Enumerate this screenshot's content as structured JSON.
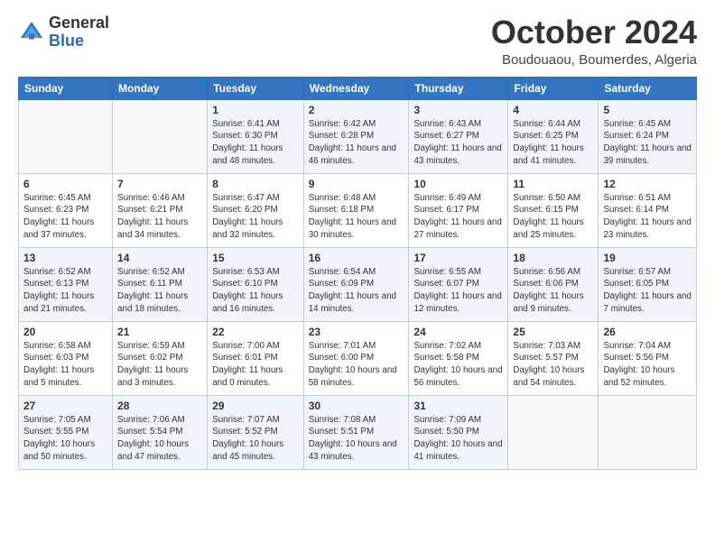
{
  "logo": {
    "general": "General",
    "blue": "Blue"
  },
  "header": {
    "month": "October 2024",
    "location": "Boudouaou, Boumerdes, Algeria"
  },
  "weekdays": [
    "Sunday",
    "Monday",
    "Tuesday",
    "Wednesday",
    "Thursday",
    "Friday",
    "Saturday"
  ],
  "weeks": [
    [
      {
        "day": "",
        "info": ""
      },
      {
        "day": "",
        "info": ""
      },
      {
        "day": "1",
        "info": "Sunrise: 6:41 AM\nSunset: 6:30 PM\nDaylight: 11 hours and 48 minutes."
      },
      {
        "day": "2",
        "info": "Sunrise: 6:42 AM\nSunset: 6:28 PM\nDaylight: 11 hours and 46 minutes."
      },
      {
        "day": "3",
        "info": "Sunrise: 6:43 AM\nSunset: 6:27 PM\nDaylight: 11 hours and 43 minutes."
      },
      {
        "day": "4",
        "info": "Sunrise: 6:44 AM\nSunset: 6:25 PM\nDaylight: 11 hours and 41 minutes."
      },
      {
        "day": "5",
        "info": "Sunrise: 6:45 AM\nSunset: 6:24 PM\nDaylight: 11 hours and 39 minutes."
      }
    ],
    [
      {
        "day": "6",
        "info": "Sunrise: 6:45 AM\nSunset: 6:23 PM\nDaylight: 11 hours and 37 minutes."
      },
      {
        "day": "7",
        "info": "Sunrise: 6:46 AM\nSunset: 6:21 PM\nDaylight: 11 hours and 34 minutes."
      },
      {
        "day": "8",
        "info": "Sunrise: 6:47 AM\nSunset: 6:20 PM\nDaylight: 11 hours and 32 minutes."
      },
      {
        "day": "9",
        "info": "Sunrise: 6:48 AM\nSunset: 6:18 PM\nDaylight: 11 hours and 30 minutes."
      },
      {
        "day": "10",
        "info": "Sunrise: 6:49 AM\nSunset: 6:17 PM\nDaylight: 11 hours and 27 minutes."
      },
      {
        "day": "11",
        "info": "Sunrise: 6:50 AM\nSunset: 6:15 PM\nDaylight: 11 hours and 25 minutes."
      },
      {
        "day": "12",
        "info": "Sunrise: 6:51 AM\nSunset: 6:14 PM\nDaylight: 11 hours and 23 minutes."
      }
    ],
    [
      {
        "day": "13",
        "info": "Sunrise: 6:52 AM\nSunset: 6:13 PM\nDaylight: 11 hours and 21 minutes."
      },
      {
        "day": "14",
        "info": "Sunrise: 6:52 AM\nSunset: 6:11 PM\nDaylight: 11 hours and 18 minutes."
      },
      {
        "day": "15",
        "info": "Sunrise: 6:53 AM\nSunset: 6:10 PM\nDaylight: 11 hours and 16 minutes."
      },
      {
        "day": "16",
        "info": "Sunrise: 6:54 AM\nSunset: 6:09 PM\nDaylight: 11 hours and 14 minutes."
      },
      {
        "day": "17",
        "info": "Sunrise: 6:55 AM\nSunset: 6:07 PM\nDaylight: 11 hours and 12 minutes."
      },
      {
        "day": "18",
        "info": "Sunrise: 6:56 AM\nSunset: 6:06 PM\nDaylight: 11 hours and 9 minutes."
      },
      {
        "day": "19",
        "info": "Sunrise: 6:57 AM\nSunset: 6:05 PM\nDaylight: 11 hours and 7 minutes."
      }
    ],
    [
      {
        "day": "20",
        "info": "Sunrise: 6:58 AM\nSunset: 6:03 PM\nDaylight: 11 hours and 5 minutes."
      },
      {
        "day": "21",
        "info": "Sunrise: 6:59 AM\nSunset: 6:02 PM\nDaylight: 11 hours and 3 minutes."
      },
      {
        "day": "22",
        "info": "Sunrise: 7:00 AM\nSunset: 6:01 PM\nDaylight: 11 hours and 0 minutes."
      },
      {
        "day": "23",
        "info": "Sunrise: 7:01 AM\nSunset: 6:00 PM\nDaylight: 10 hours and 58 minutes."
      },
      {
        "day": "24",
        "info": "Sunrise: 7:02 AM\nSunset: 5:58 PM\nDaylight: 10 hours and 56 minutes."
      },
      {
        "day": "25",
        "info": "Sunrise: 7:03 AM\nSunset: 5:57 PM\nDaylight: 10 hours and 54 minutes."
      },
      {
        "day": "26",
        "info": "Sunrise: 7:04 AM\nSunset: 5:56 PM\nDaylight: 10 hours and 52 minutes."
      }
    ],
    [
      {
        "day": "27",
        "info": "Sunrise: 7:05 AM\nSunset: 5:55 PM\nDaylight: 10 hours and 50 minutes."
      },
      {
        "day": "28",
        "info": "Sunrise: 7:06 AM\nSunset: 5:54 PM\nDaylight: 10 hours and 47 minutes."
      },
      {
        "day": "29",
        "info": "Sunrise: 7:07 AM\nSunset: 5:52 PM\nDaylight: 10 hours and 45 minutes."
      },
      {
        "day": "30",
        "info": "Sunrise: 7:08 AM\nSunset: 5:51 PM\nDaylight: 10 hours and 43 minutes."
      },
      {
        "day": "31",
        "info": "Sunrise: 7:09 AM\nSunset: 5:50 PM\nDaylight: 10 hours and 41 minutes."
      },
      {
        "day": "",
        "info": ""
      },
      {
        "day": "",
        "info": ""
      }
    ]
  ]
}
